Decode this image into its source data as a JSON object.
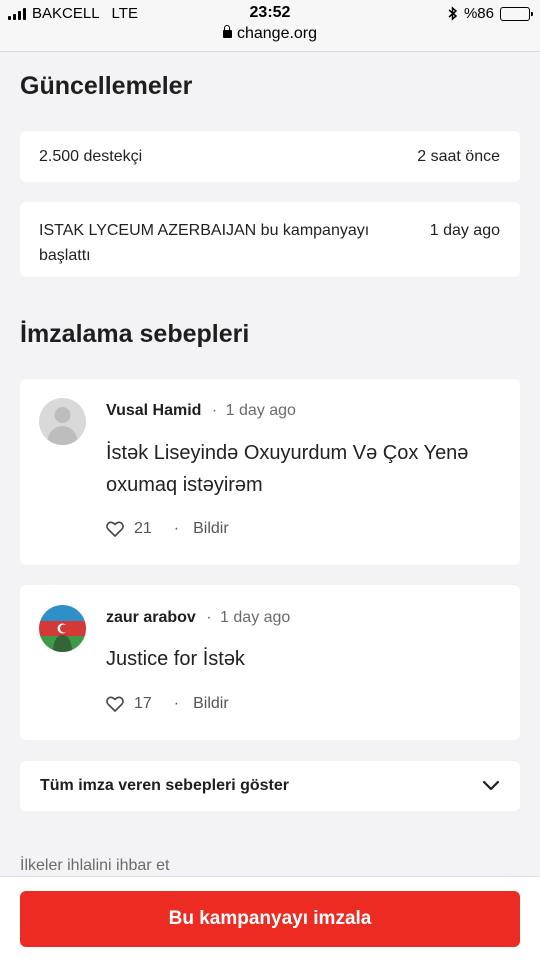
{
  "status_bar": {
    "carrier": "BAKCELL",
    "network": "LTE",
    "time": "23:52",
    "battery": "%86",
    "battery_level": 0.86,
    "url": "change.org"
  },
  "updates": {
    "title": "Güncellemeler",
    "items": [
      {
        "text": "2.500 destekçi",
        "time": "2 saat önce"
      },
      {
        "text": "ISTAK LYCEUM AZERBAIJAN bu kampanyayı başlattı",
        "time": "1 day ago"
      }
    ]
  },
  "reasons": {
    "title": "İmzalama sebepleri",
    "items": [
      {
        "author": "Vusal Hamid",
        "separator": "·",
        "time": "1 day ago",
        "text": "İstək Liseyində Oxuyurdum Və Çox Yenə oxumaq istəyirəm",
        "likes": "21",
        "report": "Bildir"
      },
      {
        "author": "zaur arabov",
        "separator": "·",
        "time": "1 day ago",
        "text": "Justice for İstək",
        "likes": "17",
        "report": "Bildir"
      }
    ],
    "show_all": "Tüm imza veren sebepleri göster"
  },
  "footer_link": "İlkeler ihlalini ihbar et",
  "sign_button": "Bu kampanyayı imzala",
  "colors": {
    "accent": "#ec2c22",
    "background": "#f3f2f4"
  }
}
